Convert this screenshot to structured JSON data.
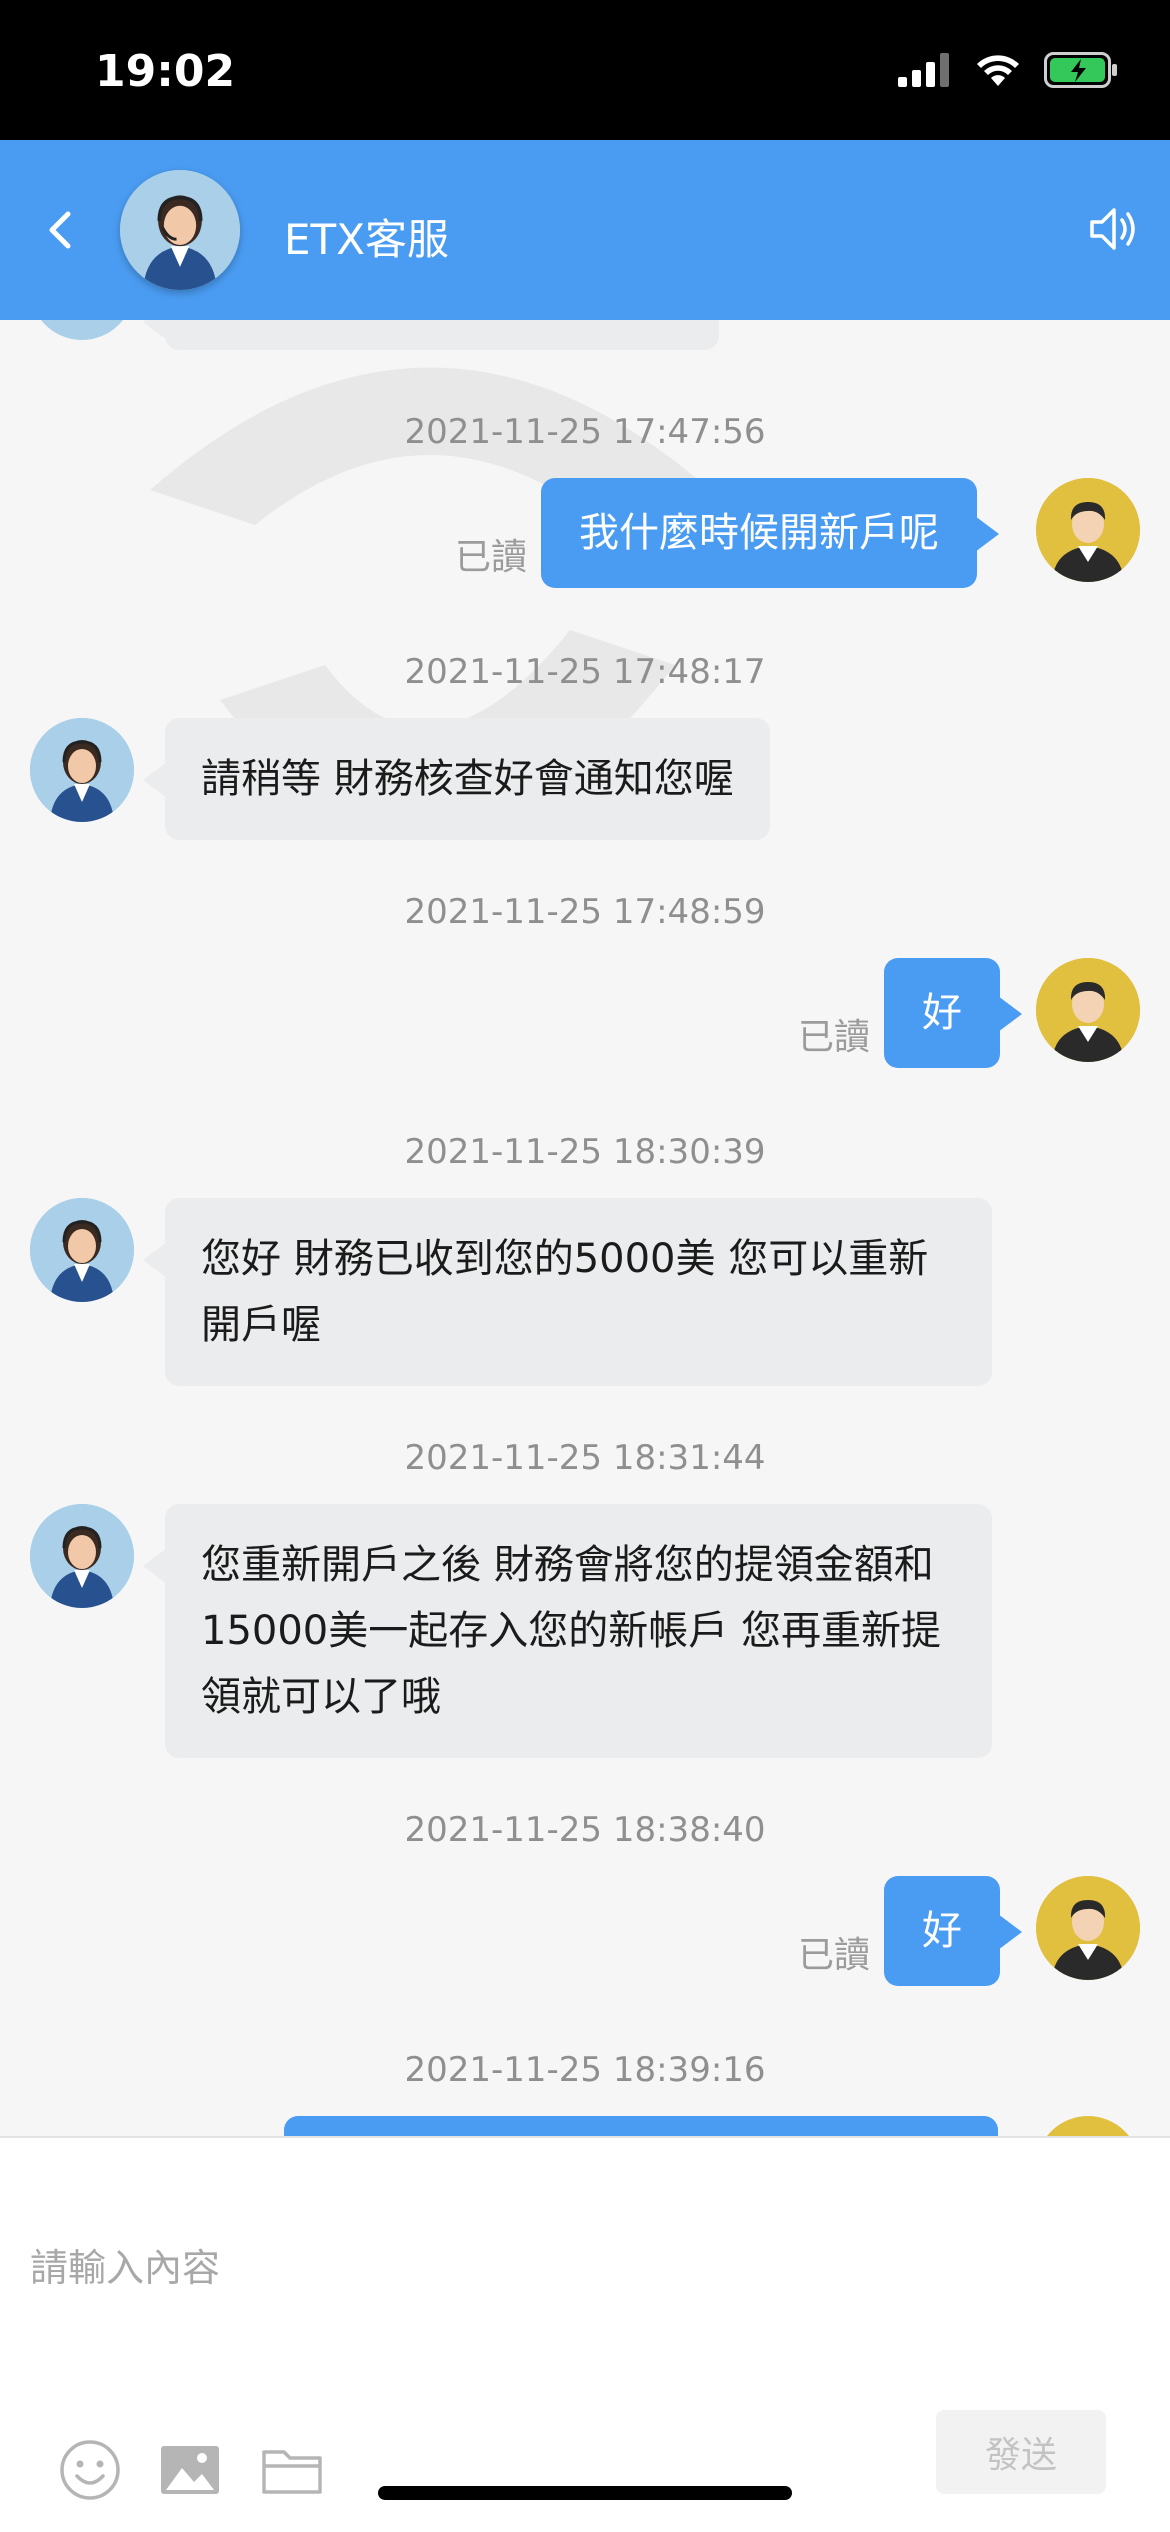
{
  "status_bar": {
    "time": "19:02"
  },
  "header": {
    "title": "ETX客服"
  },
  "messages": [
    {
      "timestamp": "2021-11-25 17:47:56",
      "sender": "user",
      "text": "我什麼時候開新戶呢",
      "read_label": "已讀"
    },
    {
      "timestamp": "2021-11-25 17:48:17",
      "sender": "agent",
      "text": "請稍等 財務核查好會通知您喔"
    },
    {
      "timestamp": "2021-11-25 17:48:59",
      "sender": "user",
      "text": "好",
      "read_label": "已讀"
    },
    {
      "timestamp": "2021-11-25 18:30:39",
      "sender": "agent",
      "text": "您好 財務已收到您的5000美 您可以重新開戶喔"
    },
    {
      "timestamp": "2021-11-25 18:31:44",
      "sender": "agent",
      "text": "您重新開戶之後 財務會將您的提領金額和15000美一起存入您的新帳戶 您再重新提領就可以了哦"
    },
    {
      "timestamp": "2021-11-25 18:38:40",
      "sender": "user",
      "text": "好",
      "read_label": "已讀"
    },
    {
      "timestamp": "2021-11-25 18:39:16",
      "sender": "user",
      "text": ""
    }
  ],
  "input": {
    "placeholder": "請輸入內容",
    "send_label": "發送"
  },
  "toolbar": {
    "icons": [
      "emoji-icon",
      "image-icon",
      "folder-icon"
    ]
  },
  "colors": {
    "accent": "#4a9cf2",
    "agent_bubble": "#ebeced",
    "user_avatar_bg": "#e1bf3f",
    "agent_avatar_bg": "#a9cfe9"
  }
}
